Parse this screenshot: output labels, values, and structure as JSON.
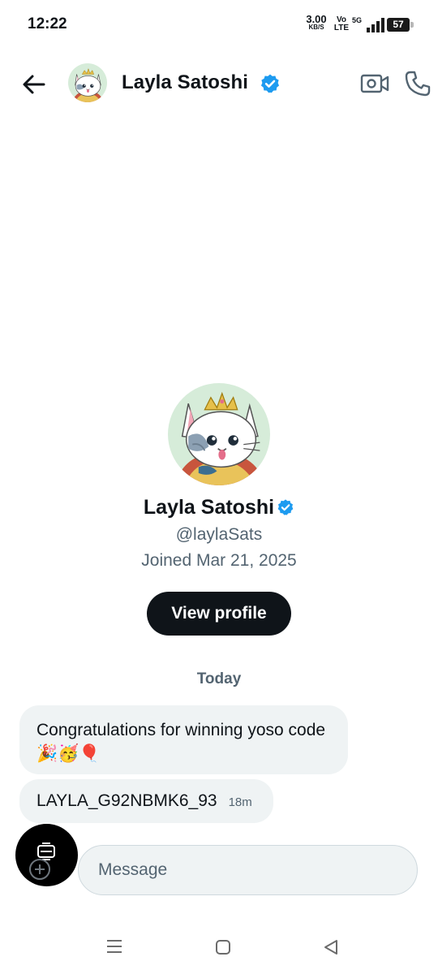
{
  "status_bar": {
    "time": "12:22",
    "speed_value": "3.00",
    "speed_unit": "KB/S",
    "volte_top": "Vo",
    "volte_bottom": "LTE",
    "network": "5G",
    "battery": "57"
  },
  "header": {
    "name": "Layla Satoshi",
    "avatar_icon": "cat-avatar-icon",
    "verified_icon": "verified-badge-icon"
  },
  "profile": {
    "name": "Layla Satoshi",
    "handle": "@laylaSats",
    "joined": "Joined Mar 21, 2025",
    "view_profile_label": "View profile"
  },
  "conversation": {
    "day_label": "Today",
    "messages": [
      {
        "text": "Congratulations for winning yoso code 🎉🥳🎈"
      },
      {
        "text": "LAYLA_G92NBMK6_93",
        "time": "18m"
      }
    ]
  },
  "composer": {
    "placeholder": "Message"
  },
  "colors": {
    "accent_blue": "#1d9bf0",
    "text_primary": "#0f1419",
    "text_secondary": "#536471",
    "bubble_bg": "#eff3f4"
  }
}
